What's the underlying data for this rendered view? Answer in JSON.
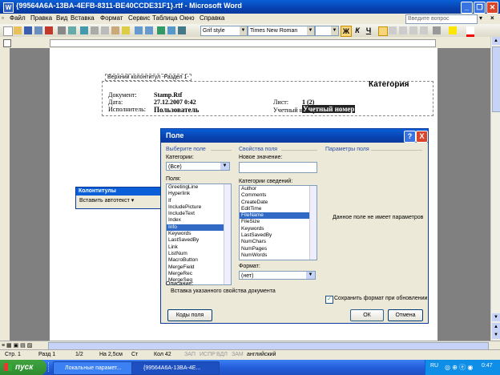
{
  "window": {
    "title": "{99564A6A-13BA-4EFB-8311-BE40CCDE31F1}.rtf - Microsoft Word",
    "app_icon": "W"
  },
  "menu": {
    "items": [
      "Файл",
      "Правка",
      "Вид",
      "Вставка",
      "Формат",
      "Сервис",
      "Таблица",
      "Окно",
      "Справка"
    ],
    "question_placeholder": "Введите вопрос"
  },
  "toolbar": {
    "style": "Grif style",
    "font": "Times New Roman",
    "bold": "Ж",
    "italic": "К",
    "underline": "Ч"
  },
  "document": {
    "header_label": "Верхний колонтитул -Раздел 1-",
    "category": "Категория",
    "doc_label": "Документ:",
    "doc_value": "Stamp.Rtf",
    "date_label": "Дата:",
    "date_value": "27.12.2007 0:42",
    "sheet_label": "Лист:",
    "sheet_value": "1 (2)",
    "author_label": "Исполнитель:",
    "author_value": "Пользователь",
    "account_label": "Учетный номер:",
    "account_value": "Учетный номер"
  },
  "hf_toolbar": {
    "title": "Колонтитулы",
    "insert_autotext": "Вставить автотекст ▾"
  },
  "dialog": {
    "title": "Поле",
    "help_btn": "?",
    "close_btn": "X",
    "choose_field_group": "Выберите поле",
    "categories_label": "Категории:",
    "categories_value": "(Все)",
    "fields_label": "Поля:",
    "fields": [
      "GreetingLine",
      "Hyperlink",
      "If",
      "IncludePicture",
      "IncludeText",
      "Index",
      "Info",
      "Keywords",
      "LastSavedBy",
      "Link",
      "ListNum",
      "MacroButton",
      "MergeField",
      "MergeRec",
      "MergeSeq"
    ],
    "fields_selected": "Info",
    "field_props_group": "Свойства поля",
    "new_value_label": "Новое значение:",
    "new_value": "",
    "info_categories_label": "Категории сведений:",
    "info_items": [
      "Author",
      "Comments",
      "CreateDate",
      "EditTime",
      "FileName",
      "FileSize",
      "Keywords",
      "LastSavedBy",
      "NumChars",
      "NumPages",
      "NumWords"
    ],
    "info_selected": "FileName",
    "format_label": "Формат:",
    "format_value": "(нет)",
    "field_params_group": "Параметры поля",
    "no_params_text": "Данное поле не имеет параметров",
    "description_label": "Описание:",
    "description_text": "Вставка указанного свойства документа",
    "preserve_format": "Сохранить формат при обновлении",
    "preserve_checked": true,
    "field_codes_btn": "Коды поля",
    "ok_btn": "ОК",
    "cancel_btn": "Отмена"
  },
  "status": {
    "page": "Стр. 1",
    "section": "Разд 1",
    "pages": "1/2",
    "position": "На 2,5см",
    "line": "Ст",
    "col": "Кол 42",
    "rec": "ЗАП",
    "trk": "ИСПР",
    "ext": "ВДЛ",
    "ovr": "ЗАМ",
    "language": "английский"
  },
  "taskbar": {
    "start": "пуск",
    "items": [
      "Локальные парамет...",
      "{99564A6A-13BA-4E..."
    ],
    "lang": "RU",
    "clock": "0:47"
  },
  "colors": {
    "title_blue": "#0a5fd8",
    "selection": "#316ac5",
    "dialog_bg": "#ece9d8",
    "start_green": "#3fa33f",
    "close_red": "#d9452b"
  }
}
